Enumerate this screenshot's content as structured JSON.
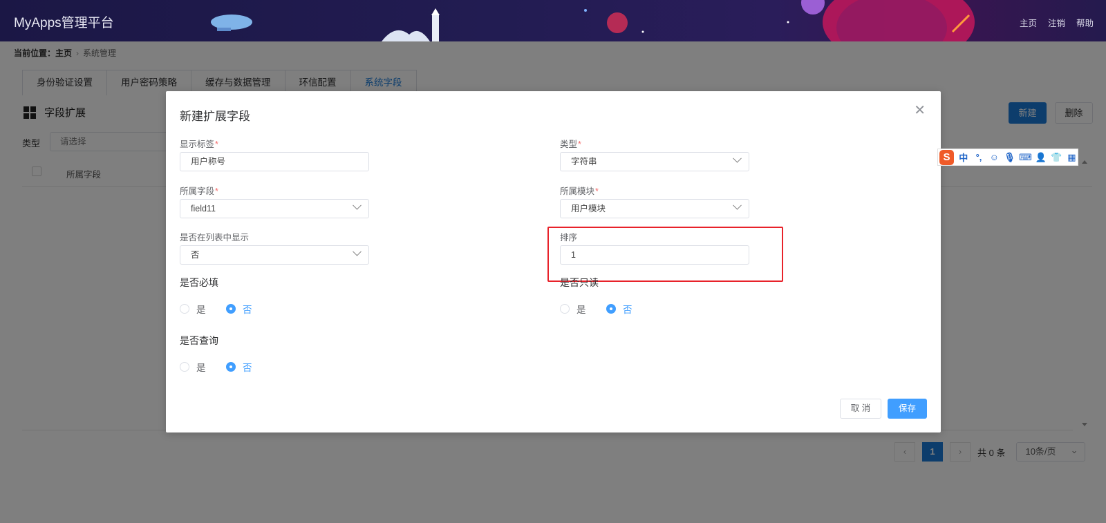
{
  "header": {
    "app_title": "MyApps管理平台",
    "links": [
      "主页",
      "注销",
      "帮助"
    ]
  },
  "breadcrumb": {
    "prefix": "当前位置：",
    "home": "主页",
    "current": "系统管理"
  },
  "tabs": [
    {
      "label": "身份验证设置",
      "active": false
    },
    {
      "label": "用户密码策略",
      "active": false
    },
    {
      "label": "缓存与数据管理",
      "active": false
    },
    {
      "label": "环信配置",
      "active": false
    },
    {
      "label": "系统字段",
      "active": true
    }
  ],
  "section": {
    "title": "字段扩展",
    "new_button": "新建",
    "delete_button": "删除",
    "filter_label": "类型",
    "filter_placeholder": "请选择",
    "column_field": "所属字段"
  },
  "pagination": {
    "current_page": "1",
    "total": "共 0 条",
    "page_size": "10条/页"
  },
  "modal": {
    "title": "新建扩展字段",
    "close_icon": "close-icon",
    "fields": {
      "display_label": {
        "label": "显示标签",
        "value": "用户称号"
      },
      "type": {
        "label": "类型",
        "value": "字符串"
      },
      "field": {
        "label": "所属字段",
        "value": "field11"
      },
      "module": {
        "label": "所属模块",
        "value": "用户模块"
      },
      "show_in_list": {
        "label": "是否在列表中显示",
        "value": "否"
      },
      "sort": {
        "label": "排序",
        "value": "1"
      }
    },
    "radio_groups": {
      "required": {
        "label": "是否必填",
        "yes": "是",
        "no": "否",
        "selected": "否"
      },
      "readonly": {
        "label": "是否只读",
        "yes": "是",
        "no": "否",
        "selected": "否"
      },
      "query": {
        "label": "是否查询",
        "yes": "是",
        "no": "否",
        "selected": "否"
      }
    },
    "cancel_button": "取 消",
    "save_button": "保存",
    "required_mark": "*"
  },
  "ime_toolbar": {
    "logo": "S",
    "mode": "中",
    "punct": "°,",
    "icons": [
      "emoji-icon",
      "microphone-icon",
      "keyboard-icon",
      "user-icon",
      "shirt-icon",
      "grid-icon"
    ]
  },
  "colors": {
    "primary": "#409eff",
    "header_bg": "#1b1745",
    "highlight_border": "#e8222a",
    "required": "#f56c6c"
  }
}
